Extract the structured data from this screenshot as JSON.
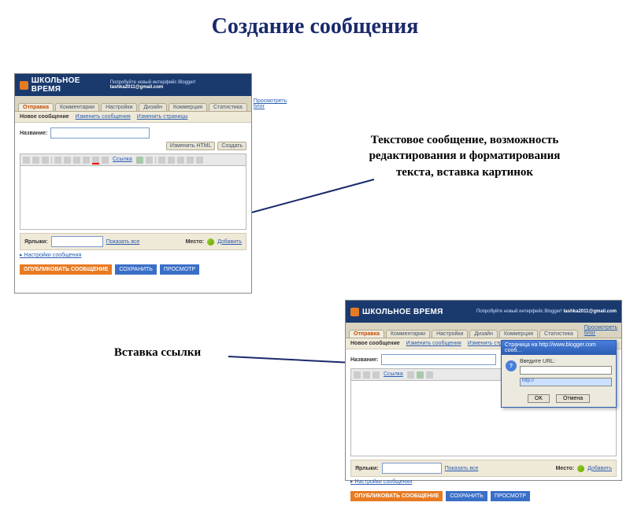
{
  "slide": {
    "title": "Создание сообщения",
    "annotation1": "Текстовое сообщение, возможность редактирования и форматирования текста, вставка картинок",
    "annotation2": "Вставка ссылки"
  },
  "blogger": {
    "site_name": "ШКОЛЬНОЕ ВРЕМЯ",
    "try_new": "Попробуйте новый интерфейс Blogger!",
    "email": "tashka2011@gmail.com",
    "tabs": [
      "Отправка",
      "Комментарии",
      "Настройки",
      "Дизайн",
      "Коммерция",
      "Статистика"
    ],
    "view_blog": "Просмотреть блог",
    "subtabs": [
      "Новое сообщение",
      "Изменить сообщения",
      "Изменить страницы"
    ],
    "title_label": "Название:",
    "btn_html": "Изменить HTML",
    "btn_create": "Создать",
    "tool_link": "Ссылка",
    "labels_label": "Ярлыки:",
    "show_all": "Показать все",
    "location_label": "Место:",
    "add_label": "Добавить",
    "prefs": "Настройки сообщения",
    "publish": "ОПУБЛИКОВАТЬ СООБЩЕНИЕ",
    "save": "СОХРАНИТЬ",
    "preview": "ПРОСМОТР"
  },
  "dialog": {
    "title": "Страница на http://www.blogger.com сооб…",
    "label": "Введите URL:",
    "value": "http://",
    "ok": "OK",
    "cancel": "Отмена"
  }
}
